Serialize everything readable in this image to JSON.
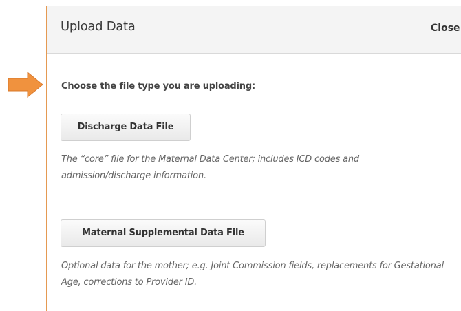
{
  "dialog": {
    "title": "Upload Data",
    "close_label": "Close"
  },
  "prompt": "Choose the file type you are uploading:",
  "options": [
    {
      "button_label": "Discharge Data File",
      "description": "The “core” file for the Maternal Data Center; includes ICD codes and admission/discharge information."
    },
    {
      "button_label": "Maternal Supplemental Data File",
      "description": "Optional data for the mother; e.g. Joint Commission fields, replacements for Gestational Age, corrections to Provider ID."
    }
  ],
  "colors": {
    "arrow": "#f0923e",
    "dialog_border": "#e59a52",
    "header_bg": "#f4f4f4"
  }
}
